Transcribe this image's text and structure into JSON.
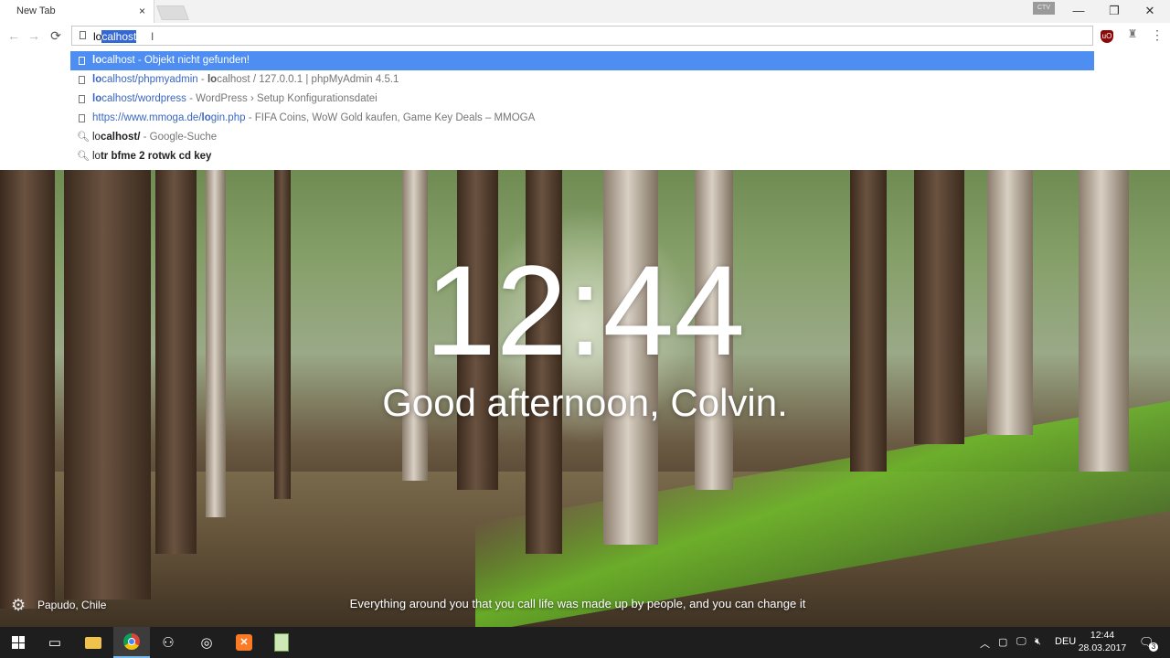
{
  "browser": {
    "tab_title": "New Tab",
    "tab_close": "×",
    "profile_badge": "CTV",
    "window_controls": {
      "minimize": "—",
      "restore": "❐",
      "close": "✕"
    },
    "nav": {
      "back": "←",
      "forward": "→",
      "reload": "⟳"
    },
    "omnibox": {
      "typed": "lo",
      "autocompleted": "calhost"
    },
    "extensions": {
      "ublock": "uO",
      "extension2": "♜",
      "menu": "⋮"
    }
  },
  "suggestions": [
    {
      "url_bold": "lo",
      "url_rest": "calhost",
      "desc": " - Objekt nicht gefunden!",
      "type": "page",
      "selected": true
    },
    {
      "url_bold": "lo",
      "url_rest": "calhost/phpmyadmin",
      "desc_prefix": " - ",
      "desc_bold": "lo",
      "desc": "calhost / 127.0.0.1 | phpMyAdmin 4.5.1",
      "type": "page"
    },
    {
      "url_bold": "lo",
      "url_rest": "calhost/wordpress",
      "desc": " - WordPress › Setup Konfigurationsdatei",
      "type": "page"
    },
    {
      "url_pre": "https://www.mmoga.de/",
      "url_bold": "lo",
      "url_rest": "gin.php",
      "desc": " - FIFA Coins, WoW Gold kaufen, Game Key Deals – MMOGA",
      "type": "page"
    },
    {
      "q_plain": "lo",
      "q_bold": "calhost/",
      "desc": " - Google-Suche",
      "type": "search"
    },
    {
      "q_plain": "lo",
      "q_bold": "tr bfme 2 rotwk cd key",
      "type": "search"
    }
  ],
  "dashboard": {
    "time": "12:44",
    "greeting": "Good afternoon, Colvin.",
    "location": "Papudo, Chile",
    "quote": "Everything around you that you call life was made up by people, and you can change it"
  },
  "taskbar": {
    "language": "DEU",
    "time": "12:44",
    "date": "28.03.2017",
    "notification_count": "3"
  }
}
